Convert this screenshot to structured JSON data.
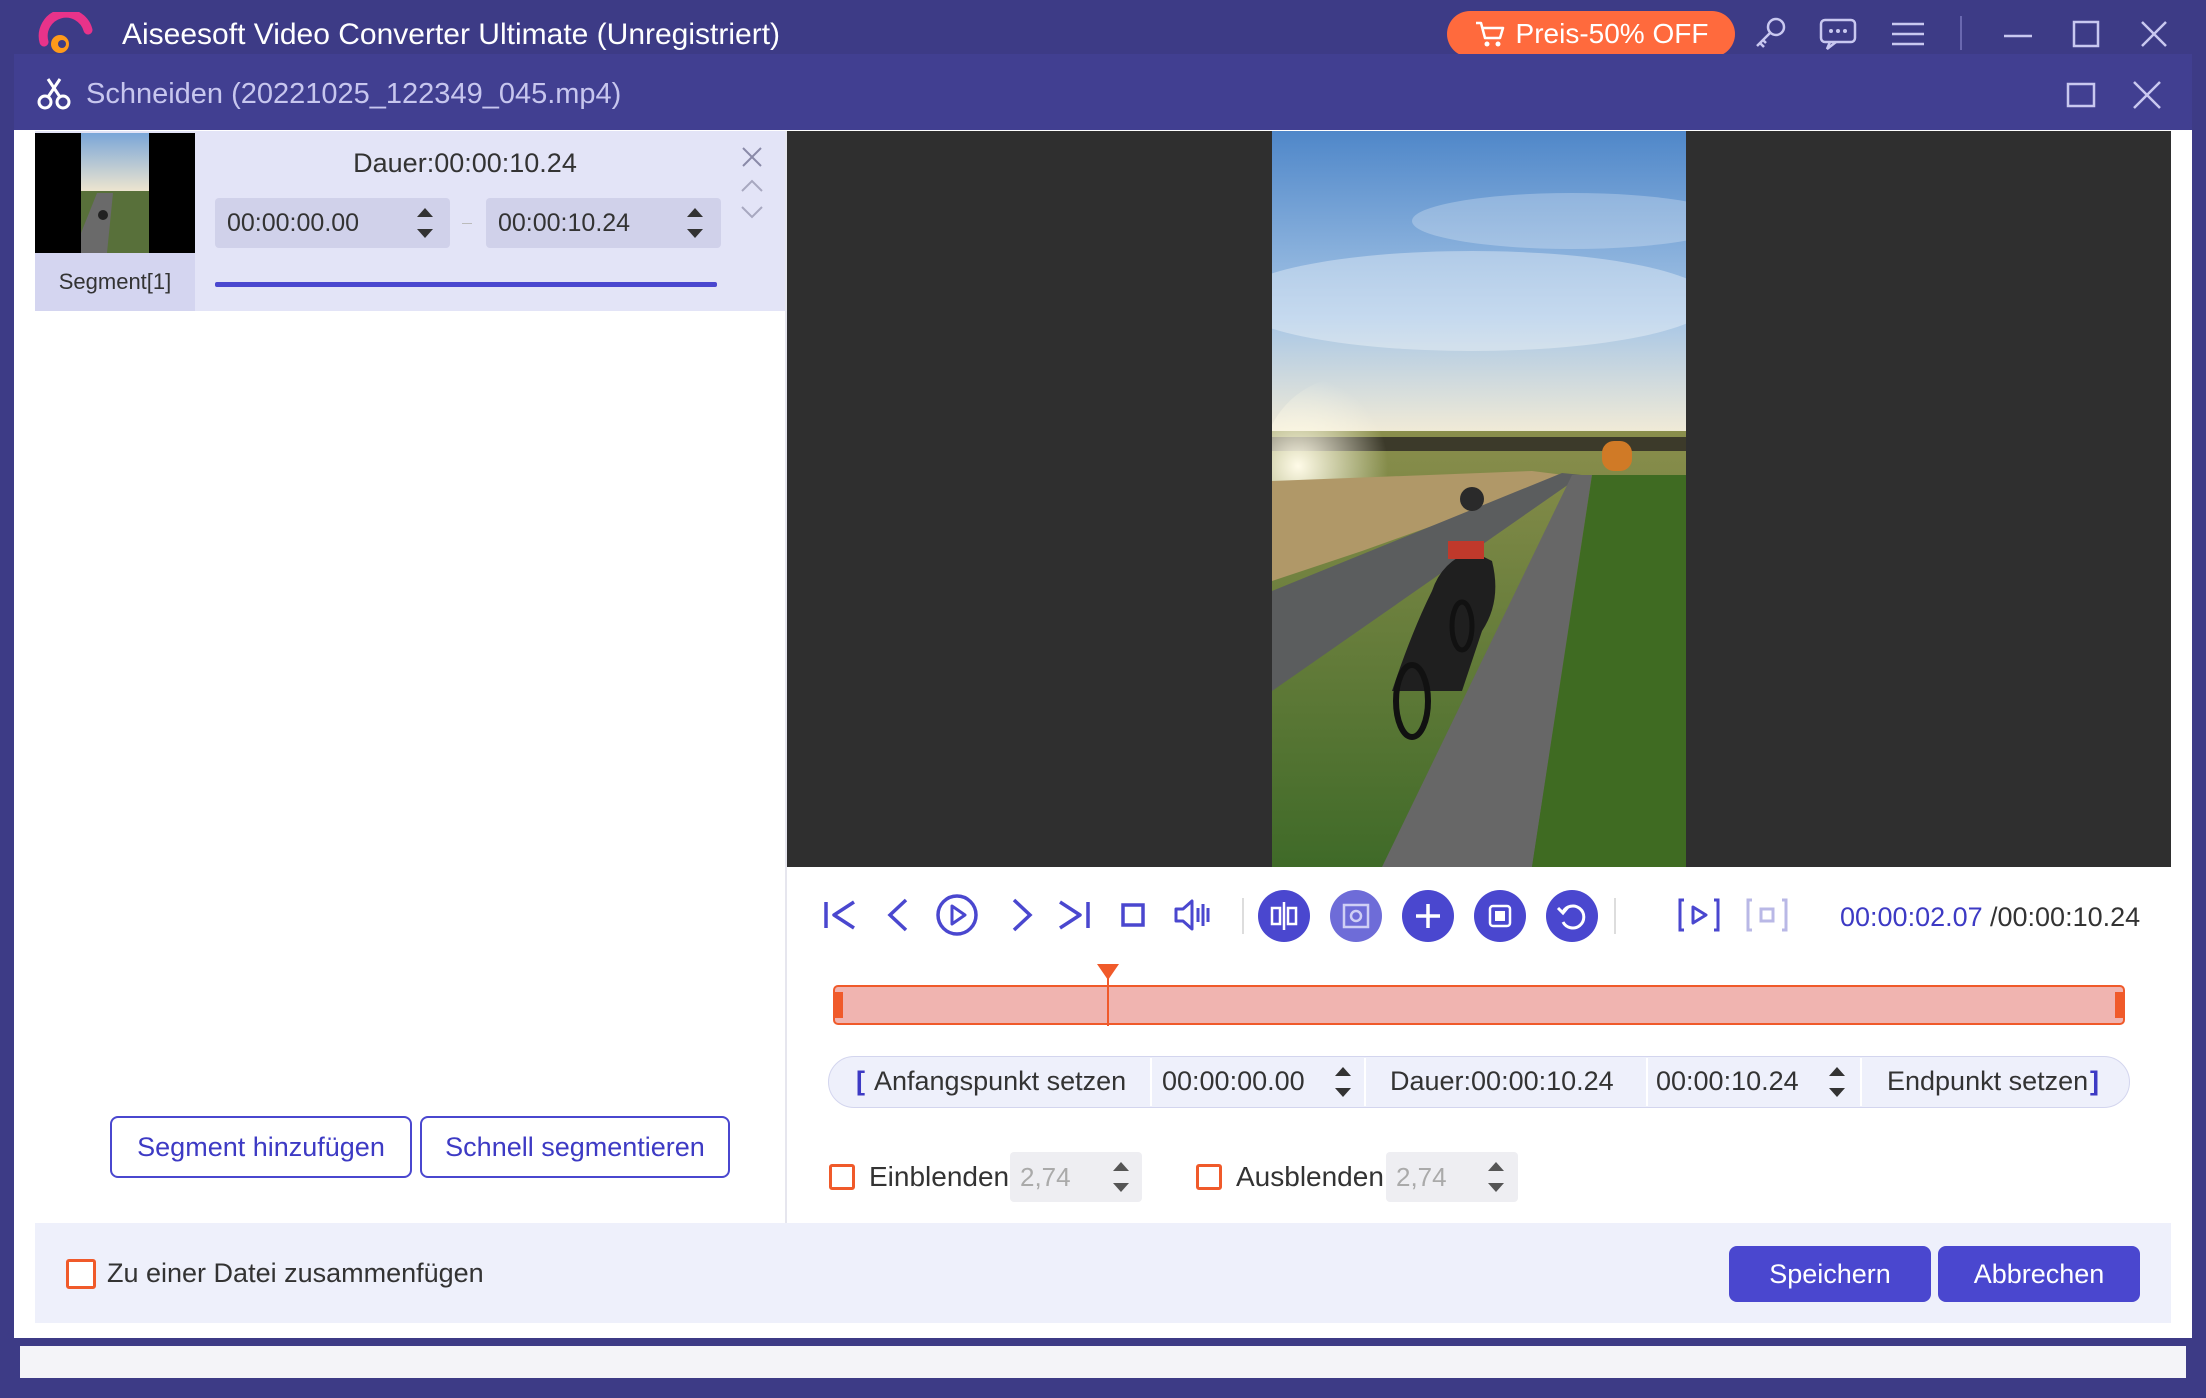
{
  "app": {
    "title": "Aiseesoft Video Converter Ultimate (Unregistriert)",
    "promo_label": "Preis-50% OFF",
    "icons": [
      "cart-icon",
      "key-icon",
      "chat-icon",
      "menu-icon",
      "minimize-icon",
      "maximize-icon",
      "close-icon"
    ]
  },
  "dialog": {
    "title": "Schneiden (20221025_122349_045.mp4)",
    "icons": [
      "scissors-icon",
      "maximize-icon",
      "close-icon"
    ]
  },
  "segment": {
    "duration": "Dauer:00:00:10.24",
    "start": "00:00:00.00",
    "end": "00:00:10.24",
    "label": "Segment[1]"
  },
  "left_buttons": {
    "add_segment": "Segment hinzufügen",
    "quick_split": "Schnell segmentieren"
  },
  "player": {
    "current_time": "00:00:02.07",
    "total_time": "/00:00:10.24",
    "playhead_fraction": 0.2
  },
  "trim": {
    "set_start": "Anfangspunkt setzen",
    "start_value": "00:00:00.00",
    "duration": "Dauer:00:00:10.24",
    "end_value": "00:00:10.24",
    "set_end": "Endpunkt setzen"
  },
  "fade": {
    "fade_in_label": "Einblenden",
    "fade_in_value": "2,74",
    "fade_out_label": "Ausblenden",
    "fade_out_value": "2,74"
  },
  "footer": {
    "merge_label": "Zu einer Datei zusammenfügen",
    "save": "Speichern",
    "cancel": "Abbrechen"
  },
  "colors": {
    "accent": "#4a47cf",
    "title_bar": "#3d3b86",
    "promo": "#ff6a3d",
    "timeline_fill": "#f0b4b0",
    "timeline_border": "#f05a2a"
  }
}
